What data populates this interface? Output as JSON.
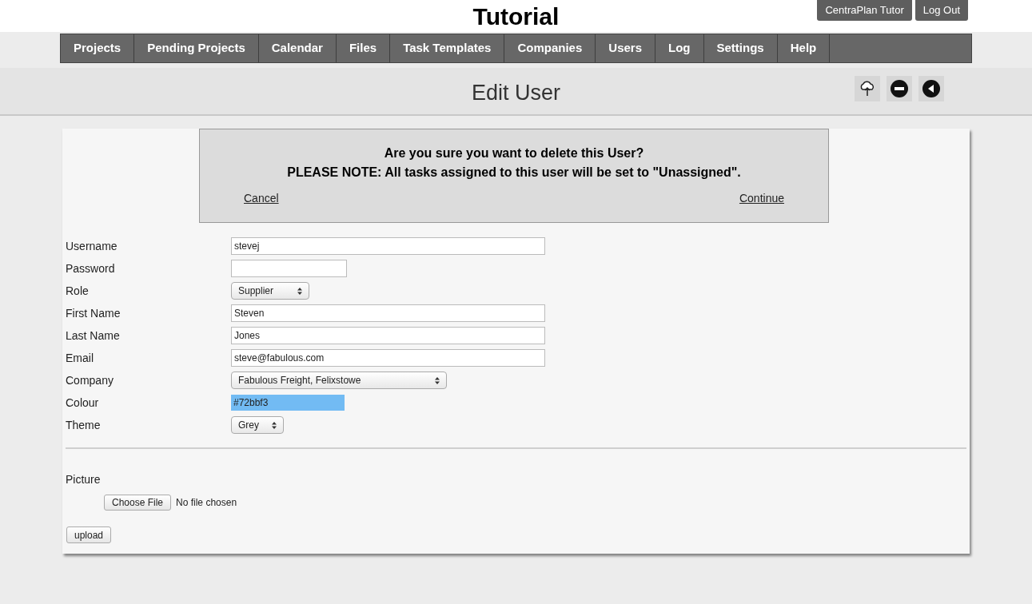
{
  "header": {
    "title": "Tutorial",
    "buttons": [
      "CentraPlan Tutor",
      "Log Out"
    ]
  },
  "nav": [
    "Projects",
    "Pending Projects",
    "Calendar",
    "Files",
    "Task Templates",
    "Companies",
    "Users",
    "Log",
    "Settings",
    "Help"
  ],
  "page": {
    "title": "Edit User"
  },
  "dialog": {
    "question": "Are you sure you want to delete this User?",
    "note": "PLEASE NOTE: All tasks assigned to this user will be set to \"Unassigned\".",
    "cancel": "Cancel",
    "continue": "Continue"
  },
  "fields": [
    {
      "label": "Username",
      "kind": "text",
      "value": "stevej"
    },
    {
      "label": "Password",
      "kind": "text"
    },
    {
      "label": "Role",
      "kind": "select",
      "value": "Supplier"
    },
    {
      "label": "First Name",
      "kind": "text",
      "value": "Steven"
    },
    {
      "label": "Last Name",
      "kind": "text",
      "value": "Jones"
    },
    {
      "label": "Email",
      "kind": "text",
      "value": "steve@fabulous.com"
    },
    {
      "label": "Company",
      "kind": "select",
      "value": "Fabulous Freight, Felixstowe"
    },
    {
      "label": "Colour",
      "kind": "color",
      "value": "#72bbf3"
    },
    {
      "label": "Theme",
      "kind": "select",
      "value": "Grey"
    }
  ],
  "picture": {
    "label": "Picture",
    "button": "Choose File",
    "status": "No file chosen",
    "upload": "upload"
  }
}
